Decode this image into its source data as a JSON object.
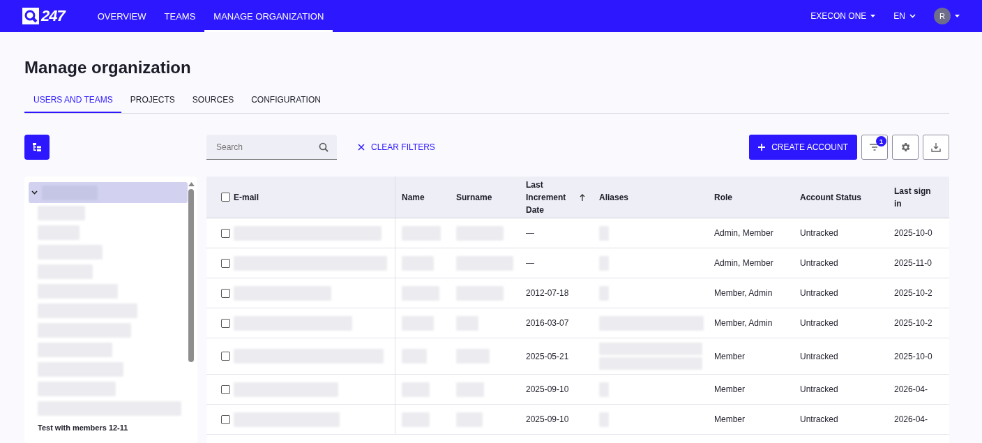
{
  "nav": {
    "logo": "247",
    "tabs": [
      {
        "label": "OVERVIEW",
        "selected": false
      },
      {
        "label": "TEAMS",
        "selected": false
      },
      {
        "label": "MANAGE ORGANIZATION",
        "selected": true
      }
    ],
    "org": "EXECON ONE",
    "language": "EN",
    "avatar": "R"
  },
  "page": {
    "title": "Manage organization",
    "tabs": [
      {
        "label": "USERS AND TEAMS",
        "selected": true
      },
      {
        "label": "PROJECTS",
        "selected": false
      },
      {
        "label": "SOURCES",
        "selected": false
      },
      {
        "label": "CONFIGURATION",
        "selected": false
      }
    ]
  },
  "toolbar": {
    "search": {
      "placeholder": "Search"
    },
    "clear_filters": "CLEAR FILTERS",
    "create_account": "CREATE ACCOUNT",
    "filter_count": "1"
  },
  "tree": [
    {
      "expanded": true,
      "selected": true,
      "children": [
        {
          "selected": false
        },
        {
          "selected": false
        },
        {
          "selected": false
        },
        {
          "selected": false
        },
        {
          "selected": false
        },
        {
          "selected": false
        },
        {
          "selected": false
        },
        {
          "selected": false
        },
        {
          "selected": false
        },
        {
          "selected": false
        },
        {
          "selected": false
        },
        {
          "label": "Test with members 12-11",
          "selected": false
        }
      ]
    }
  ],
  "table": {
    "columns": [
      {
        "label": "E-mail",
        "sorted": false
      },
      {
        "label": "Name",
        "sorted": false
      },
      {
        "label": "Surname",
        "sorted": false
      },
      {
        "label": "Last Increment Date",
        "sorted": true
      },
      {
        "label": "Aliases",
        "sorted": false
      },
      {
        "label": "Role",
        "sorted": false
      },
      {
        "label": "Account Status",
        "sorted": false
      },
      {
        "label": "Last sign in",
        "sorted": false
      }
    ],
    "all_checked": false,
    "rows": [
      {
        "checked": false,
        "last_increment": "—",
        "role": "Admin, Member",
        "status": "Untracked",
        "last_sign_in": "2025-10-0"
      },
      {
        "checked": false,
        "last_increment": "—",
        "role": "Admin, Member",
        "status": "Untracked",
        "last_sign_in": "2025-11-0"
      },
      {
        "checked": false,
        "last_increment": "2012-07-18",
        "role": "Member, Admin",
        "status": "Untracked",
        "last_sign_in": "2025-10-2"
      },
      {
        "checked": false,
        "last_increment": "2016-03-07",
        "role": "Member, Admin",
        "status": "Untracked",
        "last_sign_in": "2025-10-2"
      },
      {
        "checked": false,
        "last_increment": "2025-05-21",
        "role": "Member",
        "status": "Untracked",
        "last_sign_in": "2025-10-0"
      },
      {
        "checked": false,
        "last_increment": "2025-09-10",
        "role": "Member",
        "status": "Untracked",
        "last_sign_in": "2026-04-"
      },
      {
        "checked": false,
        "last_increment": "2025-09-10",
        "role": "Member",
        "status": "Untracked",
        "last_sign_in": "2026-04-"
      }
    ]
  }
}
